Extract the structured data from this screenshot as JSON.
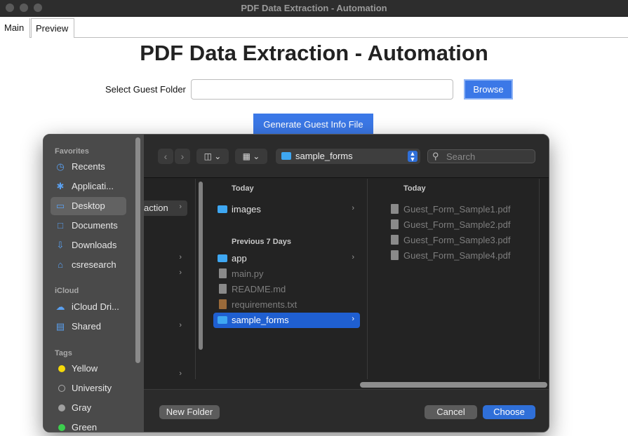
{
  "window": {
    "title": "PDF Data Extraction - Automation"
  },
  "tabs": [
    {
      "label": "Main"
    },
    {
      "label": "Preview"
    }
  ],
  "main": {
    "heading": "PDF Data Extraction - Automation",
    "folder_label": "Select Guest Folder",
    "folder_value": "",
    "browse_label": "Browse",
    "generate_label": "Generate Guest Info File"
  },
  "dialog": {
    "sidebar": {
      "favorites_title": "Favorites",
      "favorites": [
        {
          "label": "Recents",
          "icon": "clock-icon"
        },
        {
          "label": "Applicati...",
          "icon": "applications-icon"
        },
        {
          "label": "Desktop",
          "icon": "desktop-icon",
          "selected": true
        },
        {
          "label": "Documents",
          "icon": "document-icon"
        },
        {
          "label": "Downloads",
          "icon": "download-icon"
        },
        {
          "label": "csresearch",
          "icon": "home-icon"
        }
      ],
      "icloud_title": "iCloud",
      "icloud": [
        {
          "label": "iCloud Dri...",
          "icon": "cloud-icon"
        },
        {
          "label": "Shared",
          "icon": "shared-folder-icon"
        }
      ],
      "tags_title": "Tags",
      "tags": [
        {
          "label": "Yellow",
          "color": "#f5d90a"
        },
        {
          "label": "University",
          "color": ""
        },
        {
          "label": "Gray",
          "color": "#9a9a9a"
        },
        {
          "label": "Green",
          "color": "#3ccf4e"
        }
      ]
    },
    "toolbar": {
      "current_folder": "sample_forms",
      "search_placeholder": "Search"
    },
    "column1": {
      "partial_item": "action"
    },
    "column2": {
      "today_header": "Today",
      "today_items": [
        {
          "label": "images",
          "kind": "folder"
        }
      ],
      "prev_header": "Previous 7 Days",
      "prev_items": [
        {
          "label": "app",
          "kind": "folder"
        },
        {
          "label": "main.py",
          "kind": "file"
        },
        {
          "label": "README.md",
          "kind": "file"
        },
        {
          "label": "requirements.txt",
          "kind": "file"
        },
        {
          "label": "sample_forms",
          "kind": "folder",
          "selected": true
        }
      ]
    },
    "column3": {
      "header": "Today",
      "items": [
        "Guest_Form_Sample1.pdf",
        "Guest_Form_Sample2.pdf",
        "Guest_Form_Sample3.pdf",
        "Guest_Form_Sample4.pdf"
      ]
    },
    "buttons": {
      "new_folder": "New Folder",
      "cancel": "Cancel",
      "choose": "Choose"
    }
  }
}
